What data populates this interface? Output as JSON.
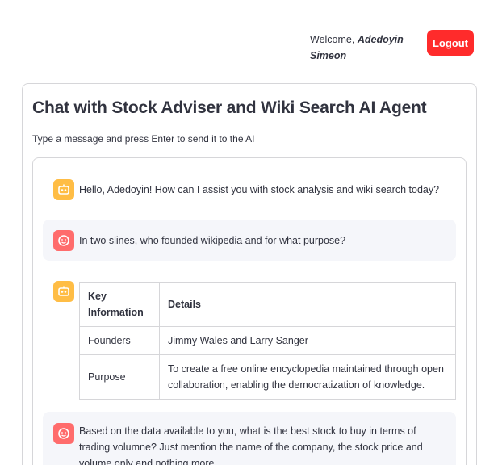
{
  "header": {
    "welcome_prefix": "Welcome, ",
    "user_name_line1": "Adedoyin",
    "user_name_line2": "Simeon",
    "logout_label": "Logout"
  },
  "page": {
    "title": "Chat with Stock Adviser and Wiki Search AI Agent",
    "subtitle": "Type a message and press Enter to send it to the AI"
  },
  "messages": [
    {
      "role": "assistant",
      "avatar_icon": "bot-icon",
      "text": "Hello, Adedoyin! How can I assist you with stock analysis and wiki search today?"
    },
    {
      "role": "user",
      "avatar_icon": "user-face-icon",
      "text": "In two slines, who founded wikipedia and for what purpose?"
    },
    {
      "role": "assistant",
      "avatar_icon": "bot-icon",
      "table": {
        "headers": [
          "Key Information",
          "Details"
        ],
        "rows": [
          [
            "Founders",
            "Jimmy Wales and Larry Sanger"
          ],
          [
            "Purpose",
            "To create a free online encyclopedia maintained through open collaboration, enabling the democratization of knowledge."
          ]
        ]
      }
    },
    {
      "role": "user",
      "avatar_icon": "user-face-icon",
      "text": "Based on the data available to you, what is the best stock to buy in terms of trading volumne? Just mention the name of the company, the stock price and volume only and nothing more"
    }
  ],
  "colors": {
    "accent_red": "#ff2b2b",
    "bot_avatar": "#ffbd45",
    "user_avatar": "#ff6c6c",
    "user_msg_bg": "#f5f6fa",
    "text": "#31333f",
    "border": "#d6d6d9"
  }
}
